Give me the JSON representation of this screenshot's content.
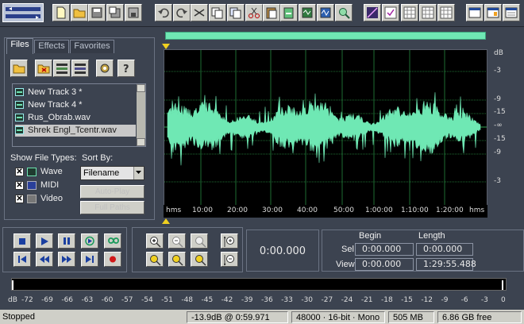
{
  "tabs": {
    "files": "Files",
    "effects": "Effects",
    "favorites": "Favorites"
  },
  "file_list": [
    {
      "name": "New Track 3 *"
    },
    {
      "name": "New Track 4 *"
    },
    {
      "name": "Rus_Obrab.wav"
    },
    {
      "name": "Shrek Engl_Tcentr.wav",
      "selected": true
    }
  ],
  "show_file_types": {
    "label": "Show File Types:",
    "items": [
      {
        "label": "Wave",
        "checked": true
      },
      {
        "label": "MIDI",
        "checked": true
      },
      {
        "label": "Video",
        "checked": true
      }
    ]
  },
  "sort": {
    "label": "Sort By:",
    "value": "Filename"
  },
  "buttons": {
    "auto_play": "Auto-Play",
    "full_paths": "Full Paths"
  },
  "db_scale": {
    "unit": "dB",
    "labels": [
      "-3",
      "-9",
      "-15",
      "-∞",
      "-15",
      "-9",
      "-3"
    ]
  },
  "time_ruler": {
    "unit": "hms",
    "labels": [
      "10:00",
      "20:00",
      "30:00",
      "40:00",
      "50:00",
      "1:00:00",
      "1:10:00",
      "1:20:00"
    ]
  },
  "time_display": "0:00.000",
  "selection": {
    "begin_header": "Begin",
    "length_header": "Length",
    "sel_label": "Sel",
    "view_label": "View",
    "sel_begin": "0:00.000",
    "sel_length": "0:00.000",
    "view_begin": "0:00.000",
    "view_length": "1:29:55.488"
  },
  "level_meter": {
    "unit": "dB",
    "labels": [
      "-72",
      "-69",
      "-66",
      "-63",
      "-60",
      "-57",
      "-54",
      "-51",
      "-48",
      "-45",
      "-42",
      "-39",
      "-36",
      "-33",
      "-30",
      "-27",
      "-24",
      "-21",
      "-18",
      "-15",
      "-12",
      "-9",
      "-6",
      "-3",
      "0"
    ]
  },
  "status_bar": {
    "state": "Stopped",
    "level_time": "-13.9dB @   0:59.971",
    "format": "48000 · 16-bit · Mono",
    "size": "505 MB",
    "free": "6.86 GB free"
  },
  "colors": {
    "waveform": "#6fe8b4",
    "background": "#3c4350",
    "grid": "#1e6b32"
  }
}
